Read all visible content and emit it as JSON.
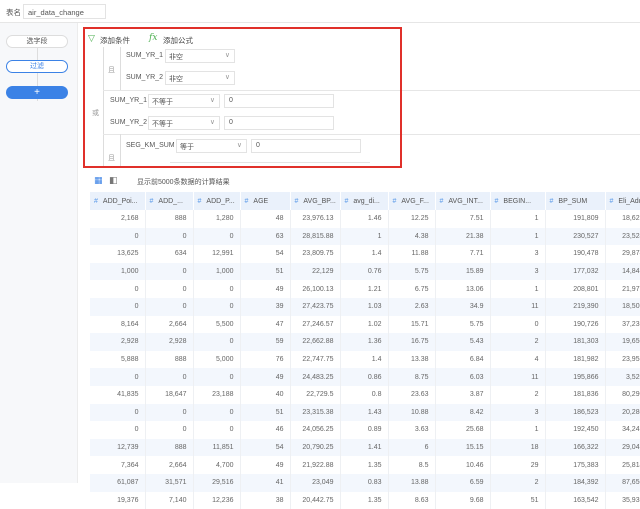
{
  "topbar": {
    "table_label": "表名",
    "table_name": "air_data_change"
  },
  "steps": {
    "select_fields": "选字段",
    "filter": "过滤",
    "add": "+"
  },
  "filter": {
    "add_condition": "添加条件",
    "add_formula": "添加公式",
    "and_label": "且",
    "or_label": "或",
    "group1": [
      {
        "field": "SUM_YR_1",
        "op": "非空"
      },
      {
        "field": "SUM_YR_2",
        "op": "非空"
      }
    ],
    "or_rows": [
      {
        "field": "SUM_YR_1",
        "op": "不等于",
        "value": "0"
      },
      {
        "field": "SUM_YR_2",
        "op": "不等于",
        "value": "0"
      }
    ],
    "group2": [
      {
        "field": "SEG_KM_SUM",
        "op": "等于",
        "value": "0"
      }
    ]
  },
  "preview": {
    "caption": "显示前5000条数据的计算结果",
    "icons": [
      "grid-view-icon",
      "panel-view-icon"
    ]
  },
  "table": {
    "columns": [
      "ADD_Poi...",
      "ADD_...",
      "ADD_P...",
      "AGE",
      "AVG_BP...",
      "avg_di...",
      "AVG_F...",
      "AVG_INT...",
      "BEGIN...",
      "BP_SUM",
      "Eli_Add_Poi..."
    ],
    "rows": [
      [
        "2,168",
        "888",
        "1,280",
        "48",
        "23,976.13",
        "1.46",
        "12.25",
        "7.51",
        "1",
        "191,809",
        "18,626"
      ],
      [
        "0",
        "0",
        "0",
        "63",
        "28,815.88",
        "1",
        "4.38",
        "21.38",
        "1",
        "230,527",
        "23,524"
      ],
      [
        "13,625",
        "634",
        "12,991",
        "54",
        "23,809.75",
        "1.4",
        "11.88",
        "7.71",
        "3",
        "190,478",
        "29,874"
      ],
      [
        "1,000",
        "0",
        "1,000",
        "51",
        "22,129",
        "0.76",
        "5.75",
        "15.89",
        "3",
        "177,032",
        "14,846"
      ],
      [
        "0",
        "0",
        "0",
        "49",
        "26,100.13",
        "1.21",
        "6.75",
        "13.06",
        "1",
        "208,801",
        "21,971"
      ],
      [
        "0",
        "0",
        "0",
        "39",
        "27,423.75",
        "1.03",
        "2.63",
        "34.9",
        "11",
        "219,390",
        "18,503"
      ],
      [
        "8,164",
        "2,664",
        "5,500",
        "47",
        "27,246.57",
        "1.02",
        "15.71",
        "5.75",
        "0",
        "190,726",
        "37,231"
      ],
      [
        "2,928",
        "2,928",
        "0",
        "59",
        "22,662.88",
        "1.36",
        "16.75",
        "5.43",
        "2",
        "181,303",
        "19,650"
      ],
      [
        "5,888",
        "888",
        "5,000",
        "76",
        "22,747.75",
        "1.4",
        "13.38",
        "6.84",
        "4",
        "181,982",
        "23,956"
      ],
      [
        "0",
        "0",
        "0",
        "49",
        "24,483.25",
        "0.86",
        "8.75",
        "6.03",
        "11",
        "195,866",
        "3,520"
      ],
      [
        "41,835",
        "18,647",
        "23,188",
        "40",
        "22,729.5",
        "0.8",
        "23.63",
        "3.87",
        "2",
        "181,836",
        "80,290"
      ],
      [
        "0",
        "0",
        "0",
        "51",
        "23,315.38",
        "1.43",
        "10.88",
        "8.42",
        "3",
        "186,523",
        "20,280"
      ],
      [
        "0",
        "0",
        "0",
        "46",
        "24,056.25",
        "0.89",
        "3.63",
        "25.68",
        "1",
        "192,450",
        "34,242"
      ],
      [
        "12,739",
        "888",
        "11,851",
        "54",
        "20,790.25",
        "1.41",
        "6",
        "15.15",
        "18",
        "166,322",
        "29,046"
      ],
      [
        "7,364",
        "2,664",
        "4,700",
        "49",
        "21,922.88",
        "1.35",
        "8.5",
        "10.46",
        "29",
        "175,383",
        "25,814"
      ],
      [
        "61,087",
        "31,571",
        "29,516",
        "41",
        "23,049",
        "0.83",
        "13.88",
        "6.59",
        "2",
        "184,392",
        "87,650"
      ],
      [
        "19,376",
        "7,140",
        "12,236",
        "38",
        "20,442.75",
        "1.35",
        "8.63",
        "9.68",
        "51",
        "163,542",
        "35,935"
      ]
    ]
  },
  "colors": {
    "accent": "#3b82e6",
    "highlight_box": "#e0302a",
    "header_bg": "#eaf1fb",
    "filter_icon": "#4caf50"
  }
}
